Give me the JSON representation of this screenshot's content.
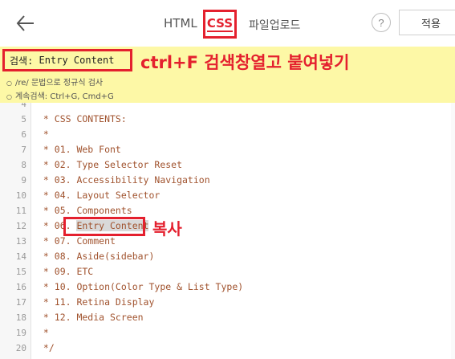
{
  "toolbar": {
    "back_icon": "arrow-left-icon",
    "tabs": [
      {
        "label": "HTML",
        "active": false
      },
      {
        "label": "CSS",
        "active": true
      },
      {
        "label": "파일업로드",
        "active": false
      }
    ],
    "help_label": "?",
    "apply_label": "적용"
  },
  "search": {
    "prefix": "검색:",
    "value": "Entry Content",
    "instruction": "ctrl+F 검색창열고 붙여넣기",
    "hints": [
      "/re/ 문법으로 정규식 검사",
      "계속검색: Ctrl+G, Cmd+G"
    ]
  },
  "editor": {
    "lines": [
      {
        "num": "4",
        "text": ""
      },
      {
        "num": "5",
        "text": " * CSS CONTENTS:"
      },
      {
        "num": "6",
        "text": " *"
      },
      {
        "num": "7",
        "text": " * 01. Web Font"
      },
      {
        "num": "8",
        "text": " * 02. Type Selector Reset"
      },
      {
        "num": "9",
        "text": " * 03. Accessibility Navigation"
      },
      {
        "num": "10",
        "text": " * 04. Layout Selector"
      },
      {
        "num": "11",
        "text": " * 05. Components"
      },
      {
        "num": "12",
        "text": " * 06. ",
        "match": "Entry Content"
      },
      {
        "num": "13",
        "text": " * 07. Comment"
      },
      {
        "num": "14",
        "text": " * 08. Aside(sidebar)"
      },
      {
        "num": "15",
        "text": " * 09. ETC"
      },
      {
        "num": "16",
        "text": " * 10. Option(Color Type & List Type)"
      },
      {
        "num": "17",
        "text": " * 11. Retina Display"
      },
      {
        "num": "18",
        "text": " * 12. Media Screen"
      },
      {
        "num": "19",
        "text": " *"
      },
      {
        "num": "20",
        "text": " */"
      }
    ],
    "copy_label": "복사"
  },
  "colors": {
    "annotation_red": "#e4202e",
    "search_panel_bg": "#fdf8a6",
    "code_text": "#a0522d",
    "line_number": "#9a9a9a"
  }
}
